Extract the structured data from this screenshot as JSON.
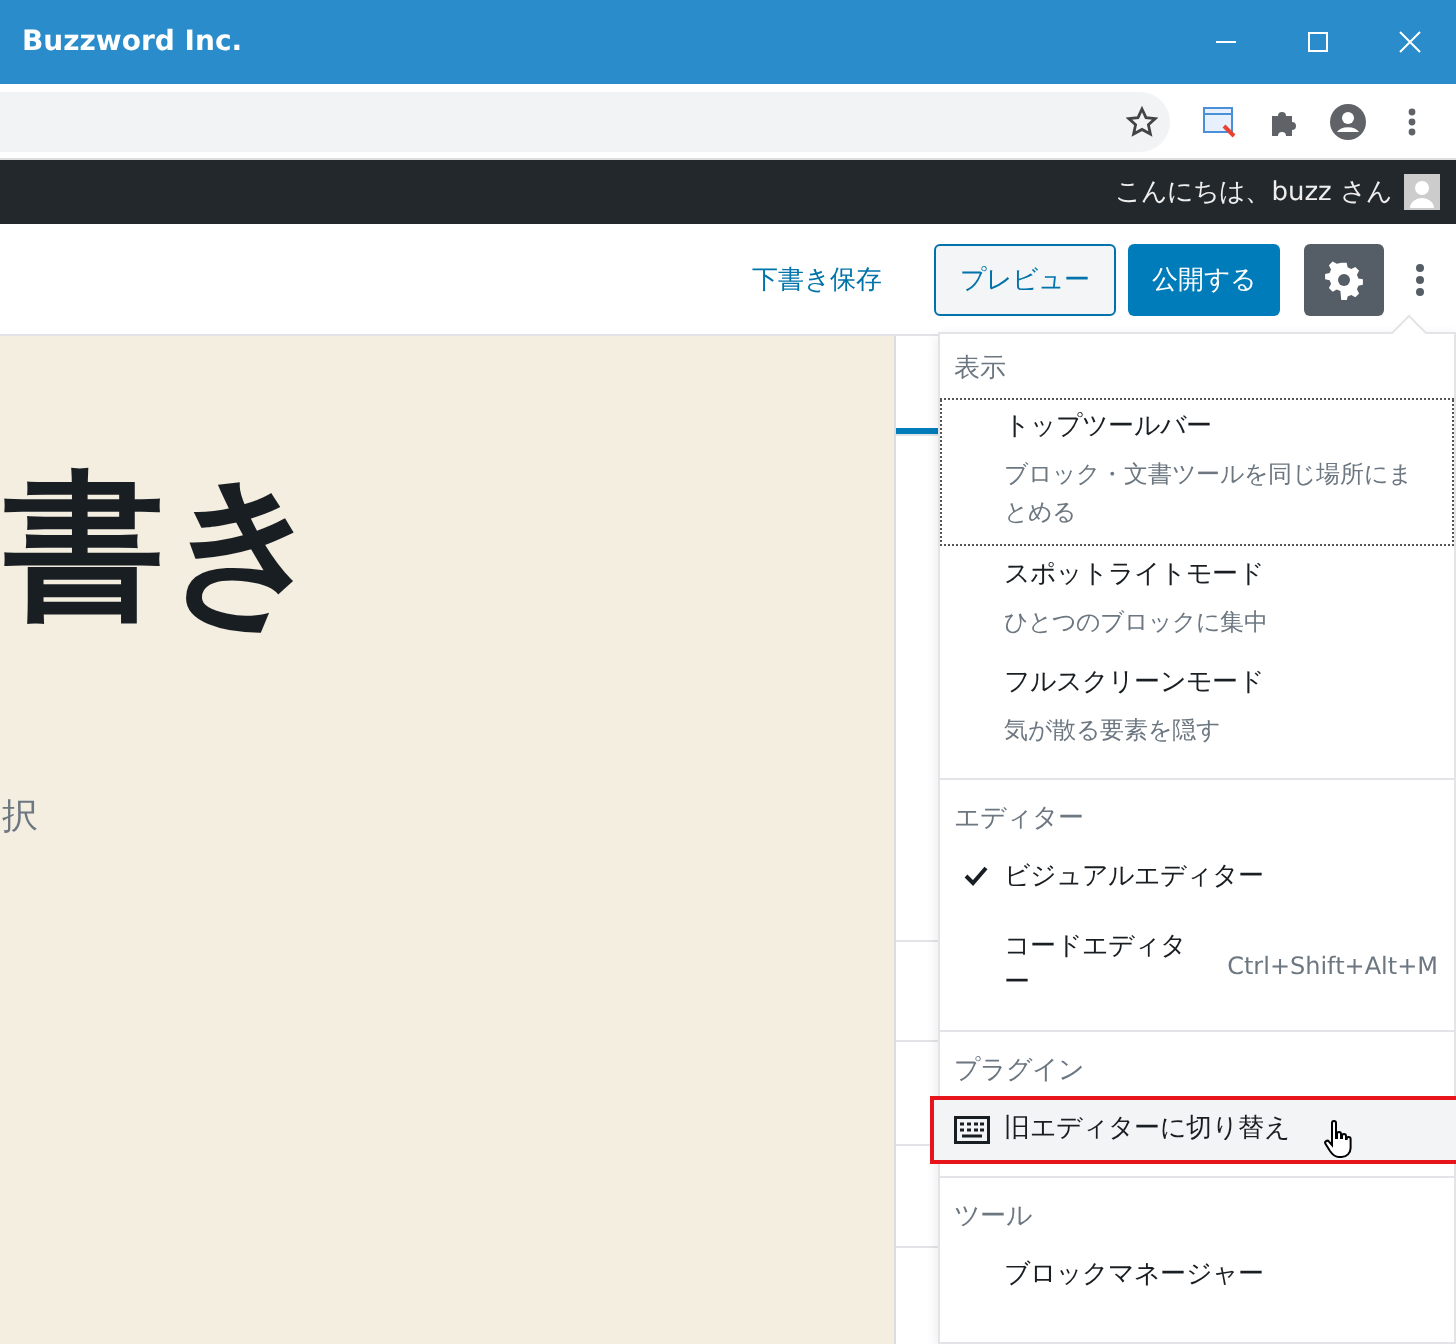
{
  "window": {
    "title": "Buzzword Inc."
  },
  "admin_bar": {
    "greeting": "こんにちは、buzz さん"
  },
  "editor_header": {
    "save_draft": "下書き保存",
    "preview": "プレビュー",
    "publish": "公開する",
    "settings_active": true
  },
  "canvas": {
    "title": "書き",
    "hint": "択"
  },
  "menu": {
    "groups": [
      {
        "heading": "表示",
        "items": [
          {
            "kind": "toggle",
            "label": "トップツールバー",
            "description": "ブロック・文書ツールを同じ場所にまとめる",
            "checked": false,
            "focused": true
          },
          {
            "kind": "toggle",
            "label": "スポットライトモード",
            "description": "ひとつのブロックに集中",
            "checked": false,
            "focused": false
          },
          {
            "kind": "toggle",
            "label": "フルスクリーンモード",
            "description": "気が散る要素を隠す",
            "checked": false,
            "focused": false
          }
        ]
      },
      {
        "heading": "エディター",
        "items": [
          {
            "kind": "radio",
            "label": "ビジュアルエディター",
            "selected": true
          },
          {
            "kind": "radio",
            "label": "コードエディター",
            "shortcut": "Ctrl+Shift+Alt+M",
            "selected": false
          }
        ]
      },
      {
        "heading": "プラグイン",
        "items": [
          {
            "kind": "plugin",
            "label": "旧エディターに切り替え",
            "highlighted": true
          }
        ]
      },
      {
        "heading": "ツール",
        "items": [
          {
            "kind": "plain",
            "label": "ブロックマネージャー"
          }
        ]
      }
    ]
  }
}
